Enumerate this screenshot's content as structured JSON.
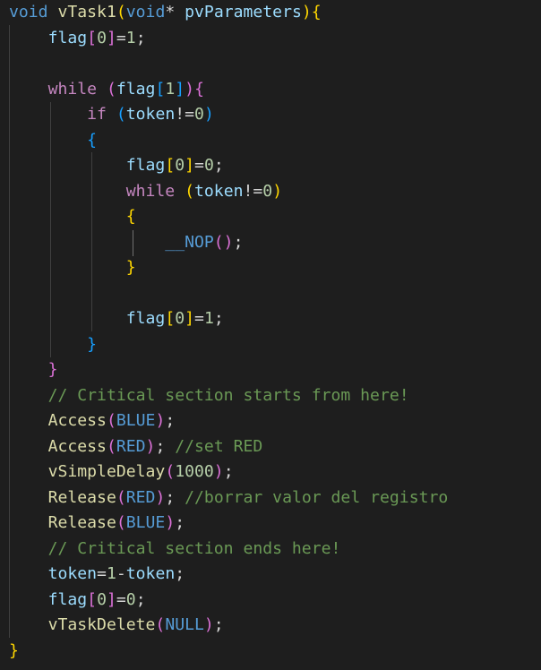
{
  "lines": [
    [
      {
        "t": "void",
        "c": "kw"
      },
      {
        "t": " ",
        "c": "op"
      },
      {
        "t": "vTask1",
        "c": "fn"
      },
      {
        "t": "(",
        "c": "br1"
      },
      {
        "t": "void",
        "c": "kw"
      },
      {
        "t": "* ",
        "c": "op"
      },
      {
        "t": "pvParameters",
        "c": "var"
      },
      {
        "t": ")",
        "c": "br1"
      },
      {
        "t": "{",
        "c": "br1"
      }
    ],
    [
      {
        "t": "    ",
        "c": "op"
      },
      {
        "t": "flag",
        "c": "var"
      },
      {
        "t": "[",
        "c": "br2"
      },
      {
        "t": "0",
        "c": "num"
      },
      {
        "t": "]",
        "c": "br2"
      },
      {
        "t": "=",
        "c": "op"
      },
      {
        "t": "1",
        "c": "num"
      },
      {
        "t": ";",
        "c": "op"
      }
    ],
    [],
    [
      {
        "t": "    ",
        "c": "op"
      },
      {
        "t": "while",
        "c": "ctrl"
      },
      {
        "t": " ",
        "c": "op"
      },
      {
        "t": "(",
        "c": "br2"
      },
      {
        "t": "flag",
        "c": "var"
      },
      {
        "t": "[",
        "c": "br3"
      },
      {
        "t": "1",
        "c": "num"
      },
      {
        "t": "]",
        "c": "br3"
      },
      {
        "t": ")",
        "c": "br2"
      },
      {
        "t": "{",
        "c": "br2"
      }
    ],
    [
      {
        "t": "        ",
        "c": "op"
      },
      {
        "t": "if",
        "c": "ctrl"
      },
      {
        "t": " ",
        "c": "op"
      },
      {
        "t": "(",
        "c": "br3"
      },
      {
        "t": "token",
        "c": "var"
      },
      {
        "t": "!=",
        "c": "op"
      },
      {
        "t": "0",
        "c": "num"
      },
      {
        "t": ")",
        "c": "br3"
      }
    ],
    [
      {
        "t": "        ",
        "c": "op"
      },
      {
        "t": "{",
        "c": "br3"
      }
    ],
    [
      {
        "t": "            ",
        "c": "op"
      },
      {
        "t": "flag",
        "c": "var"
      },
      {
        "t": "[",
        "c": "br1"
      },
      {
        "t": "0",
        "c": "num"
      },
      {
        "t": "]",
        "c": "br1"
      },
      {
        "t": "=",
        "c": "op"
      },
      {
        "t": "0",
        "c": "num"
      },
      {
        "t": ";",
        "c": "op"
      }
    ],
    [
      {
        "t": "            ",
        "c": "op"
      },
      {
        "t": "while",
        "c": "ctrl"
      },
      {
        "t": " ",
        "c": "op"
      },
      {
        "t": "(",
        "c": "br1"
      },
      {
        "t": "token",
        "c": "var"
      },
      {
        "t": "!=",
        "c": "op"
      },
      {
        "t": "0",
        "c": "num"
      },
      {
        "t": ")",
        "c": "br1"
      }
    ],
    [
      {
        "t": "            ",
        "c": "op"
      },
      {
        "t": "{",
        "c": "br1"
      }
    ],
    [
      {
        "t": "                ",
        "c": "op"
      },
      {
        "t": "__NOP",
        "c": "macro"
      },
      {
        "t": "(",
        "c": "br2"
      },
      {
        "t": ")",
        "c": "br2"
      },
      {
        "t": ";",
        "c": "op"
      }
    ],
    [
      {
        "t": "            ",
        "c": "op"
      },
      {
        "t": "}",
        "c": "br1"
      }
    ],
    [],
    [
      {
        "t": "            ",
        "c": "op"
      },
      {
        "t": "flag",
        "c": "var"
      },
      {
        "t": "[",
        "c": "br1"
      },
      {
        "t": "0",
        "c": "num"
      },
      {
        "t": "]",
        "c": "br1"
      },
      {
        "t": "=",
        "c": "op"
      },
      {
        "t": "1",
        "c": "num"
      },
      {
        "t": ";",
        "c": "op"
      }
    ],
    [
      {
        "t": "        ",
        "c": "op"
      },
      {
        "t": "}",
        "c": "br3"
      }
    ],
    [
      {
        "t": "    ",
        "c": "op"
      },
      {
        "t": "}",
        "c": "br2"
      }
    ],
    [
      {
        "t": "    ",
        "c": "op"
      },
      {
        "t": "// Critical section starts from here!",
        "c": "cmt"
      }
    ],
    [
      {
        "t": "    ",
        "c": "op"
      },
      {
        "t": "Access",
        "c": "fn"
      },
      {
        "t": "(",
        "c": "br2"
      },
      {
        "t": "BLUE",
        "c": "macro"
      },
      {
        "t": ")",
        "c": "br2"
      },
      {
        "t": ";",
        "c": "op"
      }
    ],
    [
      {
        "t": "    ",
        "c": "op"
      },
      {
        "t": "Access",
        "c": "fn"
      },
      {
        "t": "(",
        "c": "br2"
      },
      {
        "t": "RED",
        "c": "macro"
      },
      {
        "t": ")",
        "c": "br2"
      },
      {
        "t": "; ",
        "c": "op"
      },
      {
        "t": "//set RED",
        "c": "cmt"
      }
    ],
    [
      {
        "t": "    ",
        "c": "op"
      },
      {
        "t": "vSimpleDelay",
        "c": "fn"
      },
      {
        "t": "(",
        "c": "br2"
      },
      {
        "t": "1000",
        "c": "num"
      },
      {
        "t": ")",
        "c": "br2"
      },
      {
        "t": ";",
        "c": "op"
      }
    ],
    [
      {
        "t": "    ",
        "c": "op"
      },
      {
        "t": "Release",
        "c": "fn"
      },
      {
        "t": "(",
        "c": "br2"
      },
      {
        "t": "RED",
        "c": "macro"
      },
      {
        "t": ")",
        "c": "br2"
      },
      {
        "t": "; ",
        "c": "op"
      },
      {
        "t": "//borrar valor del registro",
        "c": "cmt"
      }
    ],
    [
      {
        "t": "    ",
        "c": "op"
      },
      {
        "t": "Release",
        "c": "fn"
      },
      {
        "t": "(",
        "c": "br2"
      },
      {
        "t": "BLUE",
        "c": "macro"
      },
      {
        "t": ")",
        "c": "br2"
      },
      {
        "t": ";",
        "c": "op"
      }
    ],
    [
      {
        "t": "    ",
        "c": "op"
      },
      {
        "t": "// Critical section ends here!",
        "c": "cmt"
      }
    ],
    [
      {
        "t": "    ",
        "c": "op"
      },
      {
        "t": "token",
        "c": "var"
      },
      {
        "t": "=",
        "c": "op"
      },
      {
        "t": "1",
        "c": "num"
      },
      {
        "t": "-",
        "c": "op"
      },
      {
        "t": "token",
        "c": "var"
      },
      {
        "t": ";",
        "c": "op"
      }
    ],
    [
      {
        "t": "    ",
        "c": "op"
      },
      {
        "t": "flag",
        "c": "var"
      },
      {
        "t": "[",
        "c": "br2"
      },
      {
        "t": "0",
        "c": "num"
      },
      {
        "t": "]",
        "c": "br2"
      },
      {
        "t": "=",
        "c": "op"
      },
      {
        "t": "0",
        "c": "num"
      },
      {
        "t": ";",
        "c": "op"
      }
    ],
    [
      {
        "t": "    ",
        "c": "op"
      },
      {
        "t": "vTaskDelete",
        "c": "fn"
      },
      {
        "t": "(",
        "c": "br2"
      },
      {
        "t": "NULL",
        "c": "macro"
      },
      {
        "t": ")",
        "c": "br2"
      },
      {
        "t": ";",
        "c": "op"
      }
    ],
    [
      {
        "t": "}",
        "c": "br1"
      }
    ]
  ],
  "theme": {
    "background": "#1e1e1e",
    "keyword": "#569cd6",
    "control": "#c586c0",
    "function": "#dcdcaa",
    "variable": "#9cdcfe",
    "number": "#b5cea8",
    "comment": "#6a9955",
    "bracket_level1": "#ffd700",
    "bracket_level2": "#da70d6",
    "bracket_level3": "#179fff"
  }
}
